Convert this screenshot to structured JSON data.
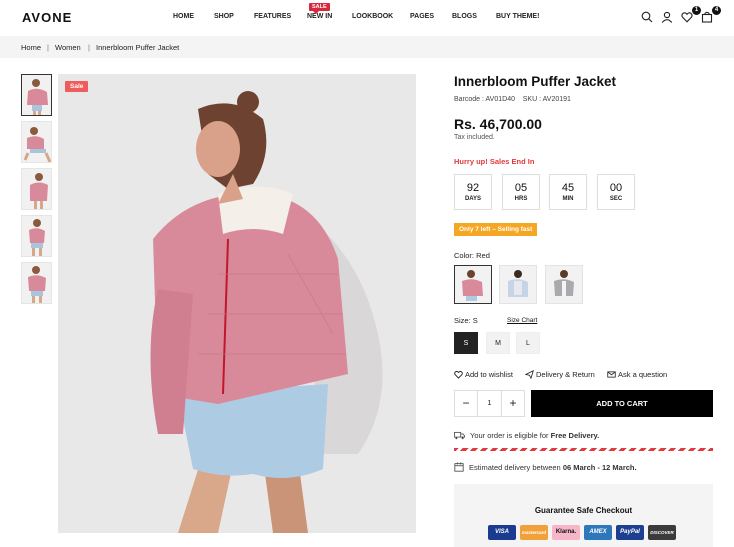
{
  "header": {
    "logo": "AVONE",
    "nav": [
      "HOME",
      "SHOP",
      "FEATURES",
      "NEW IN",
      "LOOKBOOK",
      "PAGES",
      "BLOGS",
      "BUY THEME!"
    ],
    "sale_tag": "SALE",
    "wishlist_count": "1",
    "cart_count": "4"
  },
  "breadcrumb": {
    "home": "Home",
    "sep1": "|",
    "women": "Women",
    "sep2": "|",
    "current": "Innerbloom Puffer Jacket"
  },
  "gallery": {
    "sale_badge": "Sale"
  },
  "product": {
    "title": "Innerbloom Puffer Jacket",
    "barcode_label": "Barcode :",
    "barcode": "AV01D40",
    "sku_label": "SKU :",
    "sku": "AV20191",
    "price": "Rs. 46,700.00",
    "tax_note": "Tax included.",
    "hurry": "Hurry up! Sales End In",
    "countdown": [
      {
        "value": "92",
        "label": "DAYS"
      },
      {
        "value": "05",
        "label": "HRS"
      },
      {
        "value": "45",
        "label": "MIN"
      },
      {
        "value": "00",
        "label": "SEC"
      }
    ],
    "stock": "Only 7 left – Selling fast",
    "color_label": "Color:",
    "color_value": "Red",
    "size_label": "Size:",
    "size_value": "S",
    "size_chart": "Size Chart",
    "sizes": [
      "S",
      "M",
      "L"
    ],
    "wishlist": "Add to wishlist",
    "delivery_return": "Delivery & Return",
    "ask": "Ask a question",
    "qty": "1",
    "qty_minus": "−",
    "qty_plus": "+",
    "add_to_cart": "ADD TO CART",
    "eligible_pre": "Your order is eligible for",
    "eligible_bold": "Free Delivery.",
    "est_pre": "Estimated delivery between",
    "est_bold": "06 March - 12 March.",
    "checkout_title": "Guarantee Safe Checkout",
    "payments": [
      "VISA",
      "mastercard",
      "Klarna.",
      "AMEX",
      "PayPal",
      "DISCOVER"
    ]
  },
  "colors": {
    "accent_red": "#e0393e",
    "stock_orange": "#f5a623",
    "jacket_pink": "#d98a9a"
  }
}
